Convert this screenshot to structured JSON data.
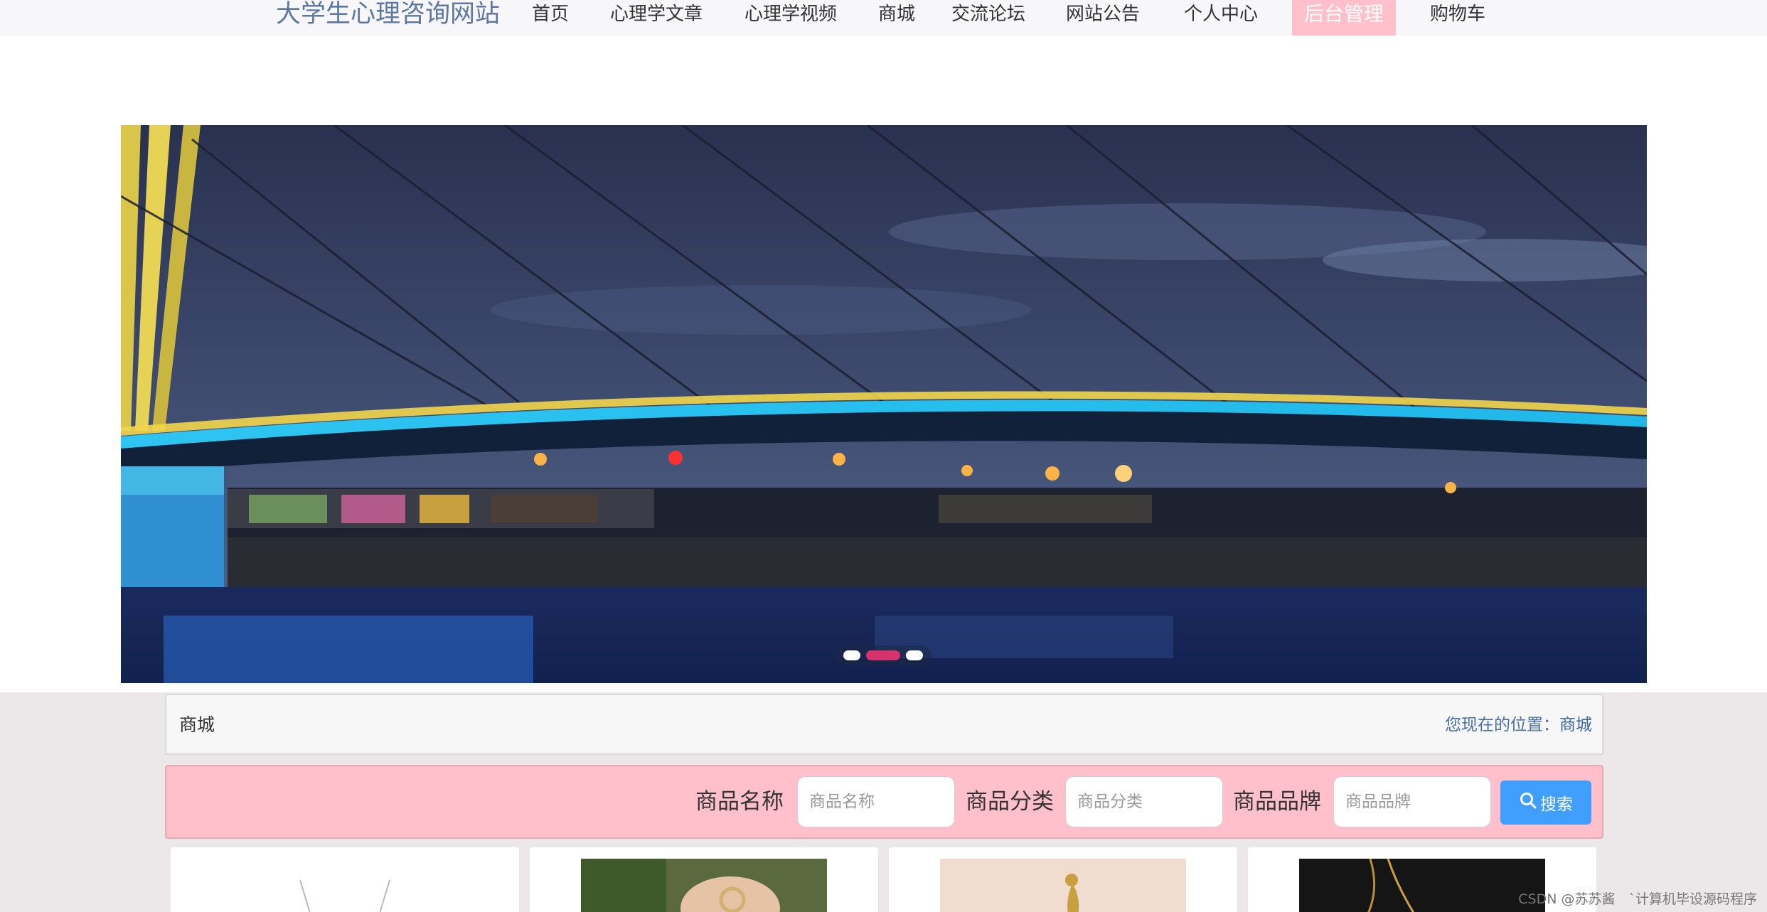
{
  "nav": {
    "site_title": "大学生心理咨询网站",
    "items": [
      {
        "label": "首页"
      },
      {
        "label": "心理学文章"
      },
      {
        "label": "心理学视频"
      },
      {
        "label": "商城"
      },
      {
        "label": "交流论坛"
      },
      {
        "label": "网站公告"
      },
      {
        "label": "个人中心"
      },
      {
        "label": "后台管理",
        "active": true
      },
      {
        "label": "购物车"
      }
    ]
  },
  "banner": {
    "image": "night-bridge-over-river",
    "slides": 3,
    "active_slide": 2
  },
  "page": {
    "section_title": "商城",
    "breadcrumb_prefix": "您现在的位置：",
    "breadcrumb_current": "商城"
  },
  "search": {
    "name_label": "商品名称",
    "name_placeholder": "商品名称",
    "category_label": "商品分类",
    "category_placeholder": "商品分类",
    "brand_label": "商品品牌",
    "brand_placeholder": "商品品牌",
    "button_label": "搜索",
    "button_icon": "search-icon"
  },
  "products": [
    {
      "image": "silver-necklace"
    },
    {
      "image": "ring-in-hand"
    },
    {
      "image": "peacock-gold-pendant"
    },
    {
      "image": "gold-chain-dark"
    }
  ],
  "colors": {
    "accent_pink": "#ffc0cb",
    "button_blue": "#409eff",
    "title_blue": "#5c77a1",
    "active_dot": "#d6336c"
  },
  "watermark": "CSDN @苏苏酱　`计算机毕设源码程序"
}
